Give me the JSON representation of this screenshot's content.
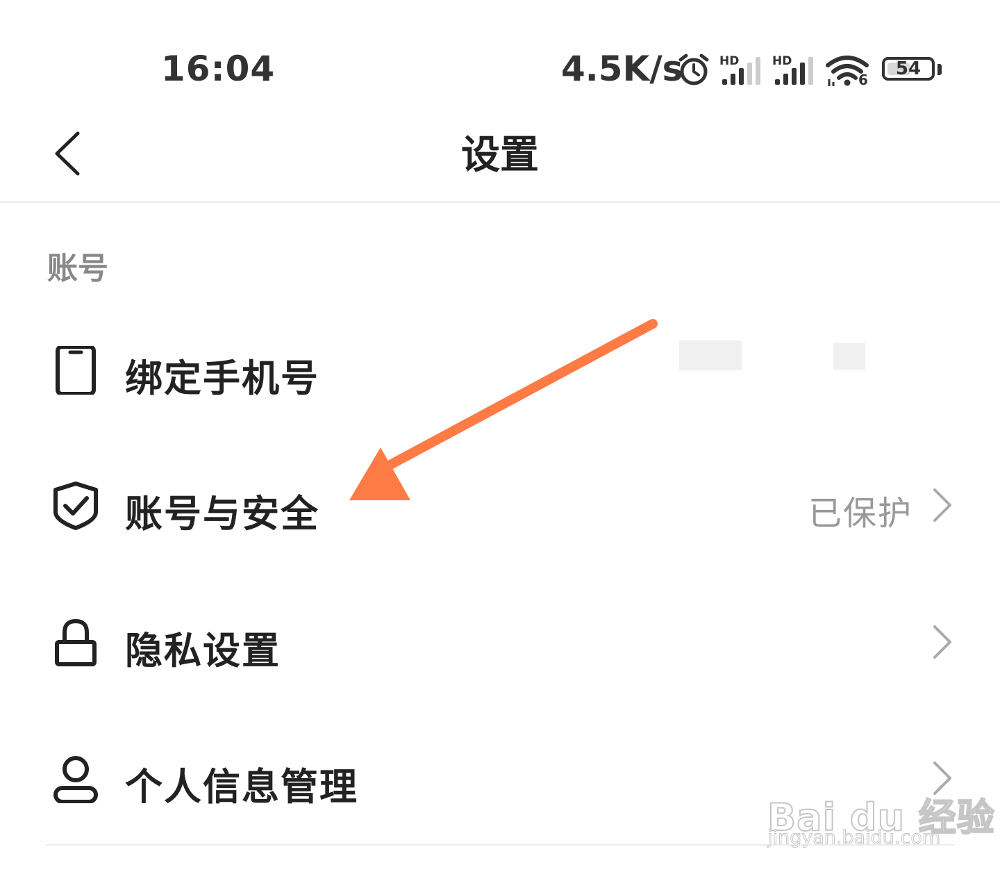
{
  "status_bar": {
    "time": "16:04",
    "net_speed": "4.5K/s",
    "sim1_label": "HD",
    "sim2_label": "HD",
    "wifi_label": "6",
    "battery_level": "54",
    "icons": [
      "alarm-icon",
      "signal-icon",
      "signal-icon",
      "wifi-icon",
      "battery-icon"
    ]
  },
  "header": {
    "back_icon": "chevron-left-icon",
    "title": "设置"
  },
  "section": {
    "title": "账号"
  },
  "items": [
    {
      "icon": "phone-icon",
      "label": "绑定手机号",
      "value": ""
    },
    {
      "icon": "shield-check-icon",
      "label": "账号与安全",
      "value": "已保护"
    },
    {
      "icon": "lock-icon",
      "label": "隐私设置",
      "value": ""
    },
    {
      "icon": "person-icon",
      "label": "个人信息管理",
      "value": ""
    }
  ],
  "annotation": {
    "color": "#FF7B45"
  },
  "watermark": {
    "brand": "Bai du 经验",
    "url": "jingyan.baidu.com"
  }
}
